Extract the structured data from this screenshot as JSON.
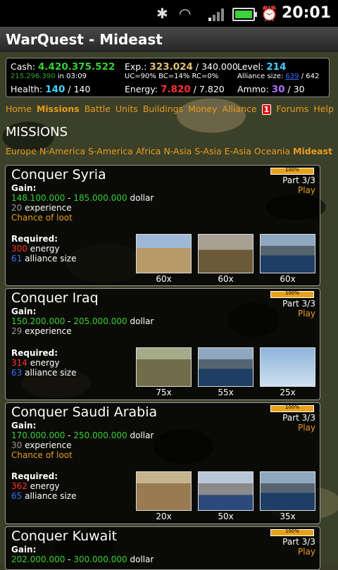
{
  "statusbar": {
    "time": "20:01",
    "battery_level": 0.85
  },
  "app": {
    "title": "WarQuest - Mideast"
  },
  "stats": {
    "cash_label": "Cash:",
    "cash": "4.420.375.522",
    "cash_income": "215.296.390",
    "cash_in": "in 03:09",
    "health_label": "Health:",
    "health": "140",
    "health_max": "/ 140",
    "exp_label": "Exp.:",
    "exp": "323.024",
    "exp_max": "/ 340.000",
    "upgrades": "UC=90% BC=14% RC=0%",
    "energy_label": "Energy:",
    "energy": "7.820",
    "energy_max": "/ 7.820",
    "level_label": "Level:",
    "level": "214",
    "alliance_label": "Alliance size:",
    "alliance": "639",
    "alliance_max": "/ 642",
    "ammo_label": "Ammo:",
    "ammo": "30",
    "ammo_max": "/ 30"
  },
  "nav": {
    "home": "Home",
    "missions": "Missions",
    "battle": "Battle",
    "units": "Units",
    "buildings": "Buildings",
    "money": "Money",
    "alliance": "Alliance",
    "alliance_badge": "1",
    "forums": "Forums",
    "help": "Help"
  },
  "heading": "MISSIONS",
  "regions": [
    "Europe",
    "N-America",
    "S-America",
    "Africa",
    "N-Asia",
    "S-Asia",
    "E-Asia",
    "Oceania",
    "Mideast"
  ],
  "missions": [
    {
      "title": "Conquer Syria",
      "progress": "100%",
      "part": "Part 3/3",
      "play": "Play",
      "gain_label": "Gain:",
      "gain_min": "148.100.000",
      "gain_max": "185.000.000",
      "gain_unit": "dollar",
      "experience": "20",
      "experience_label": "experience",
      "loot": "Chance of loot",
      "required_label": "Required:",
      "energy": "300",
      "energy_label": "energy",
      "alliance": "61",
      "alliance_label": "alliance size",
      "units": [
        {
          "icon": "soldier-icon",
          "count": "60x"
        },
        {
          "icon": "artillery-icon",
          "count": "60x"
        },
        {
          "icon": "warship-icon",
          "count": "60x"
        }
      ]
    },
    {
      "title": "Conquer Iraq",
      "progress": "100%",
      "part": "Part 3/3",
      "play": "Play",
      "gain_label": "Gain:",
      "gain_min": "150.200.000",
      "gain_max": "205.000.000",
      "gain_unit": "dollar",
      "experience": "29",
      "experience_label": "experience",
      "loot": "",
      "required_label": "Required:",
      "energy": "314",
      "energy_label": "energy",
      "alliance": "63",
      "alliance_label": "alliance size",
      "units": [
        {
          "icon": "tank-icon",
          "count": "75x"
        },
        {
          "icon": "warship-icon",
          "count": "55x"
        },
        {
          "icon": "bomber-icon",
          "count": "25x"
        }
      ]
    },
    {
      "title": "Conquer Saudi Arabia",
      "progress": "100%",
      "part": "Part 3/3",
      "play": "Play",
      "gain_label": "Gain:",
      "gain_min": "170.000.000",
      "gain_max": "250.000.000",
      "gain_unit": "dollar",
      "experience": "30",
      "experience_label": "experience",
      "loot": "Chance of loot",
      "required_label": "Required:",
      "energy": "362",
      "energy_label": "energy",
      "alliance": "65",
      "alliance_label": "alliance size",
      "units": [
        {
          "icon": "wrecked-vehicle-icon",
          "count": "20x"
        },
        {
          "icon": "aircraft-carrier-icon",
          "count": "50x"
        },
        {
          "icon": "warship-icon",
          "count": "35x"
        }
      ]
    },
    {
      "title": "Conquer Kuwait",
      "progress": "100%",
      "part": "Part 3/3",
      "play": "Play",
      "gain_label": "Gain:",
      "gain_min": "202.000.000",
      "gain_max": "300.000.000",
      "gain_unit": "dollar"
    }
  ]
}
